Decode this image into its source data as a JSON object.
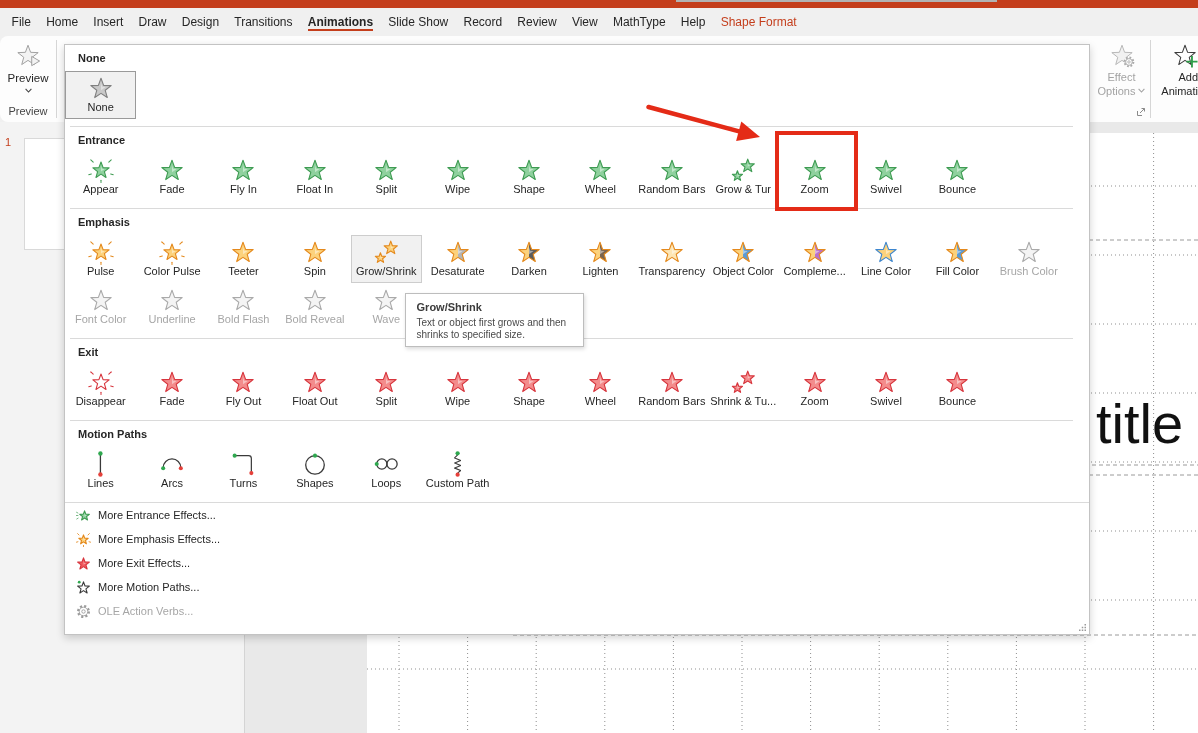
{
  "tabs": [
    {
      "label": "File",
      "selected": false,
      "contextual": false
    },
    {
      "label": "Home",
      "selected": false,
      "contextual": false
    },
    {
      "label": "Insert",
      "selected": false,
      "contextual": false
    },
    {
      "label": "Draw",
      "selected": false,
      "contextual": false
    },
    {
      "label": "Design",
      "selected": false,
      "contextual": false
    },
    {
      "label": "Transitions",
      "selected": false,
      "contextual": false
    },
    {
      "label": "Animations",
      "selected": true,
      "contextual": false
    },
    {
      "label": "Slide Show",
      "selected": false,
      "contextual": false
    },
    {
      "label": "Record",
      "selected": false,
      "contextual": false
    },
    {
      "label": "Review",
      "selected": false,
      "contextual": false
    },
    {
      "label": "View",
      "selected": false,
      "contextual": false
    },
    {
      "label": "MathType",
      "selected": false,
      "contextual": false
    },
    {
      "label": "Help",
      "selected": false,
      "contextual": false
    },
    {
      "label": "Shape Format",
      "selected": false,
      "contextual": true
    }
  ],
  "ribbon": {
    "preview_button": {
      "label": "Preview"
    },
    "preview_group_label": "Preview",
    "effect_options_button": {
      "label": "Effect Options",
      "disabled": true
    },
    "add_animation_button": {
      "label": "Add Animati"
    }
  },
  "animation_gallery": {
    "sections": [
      {
        "kind": "none",
        "title": "None",
        "items": [
          {
            "label": "None",
            "selected": true
          }
        ]
      },
      {
        "kind": "entrance",
        "title": "Entrance",
        "items": [
          {
            "label": "Appear"
          },
          {
            "label": "Fade"
          },
          {
            "label": "Fly In"
          },
          {
            "label": "Float In"
          },
          {
            "label": "Split"
          },
          {
            "label": "Wipe"
          },
          {
            "label": "Shape"
          },
          {
            "label": "Wheel"
          },
          {
            "label": "Random Bars"
          },
          {
            "label": "Grow & Tur"
          },
          {
            "label": "Zoom"
          },
          {
            "label": "Swivel"
          },
          {
            "label": "Bounce"
          }
        ]
      },
      {
        "kind": "emphasis",
        "title": "Emphasis",
        "items": [
          {
            "label": "Pulse",
            "hovered": false,
            "disabled": false
          },
          {
            "label": "Color Pulse",
            "hovered": false,
            "disabled": false
          },
          {
            "label": "Teeter",
            "hovered": false,
            "disabled": false
          },
          {
            "label": "Spin",
            "hovered": false,
            "disabled": false
          },
          {
            "label": "Grow/Shrink",
            "hovered": true,
            "disabled": false,
            "tooltip": {
              "title": "Grow/Shrink",
              "text": "Text or object first grows and then shrinks to specified size."
            }
          },
          {
            "label": "Desaturate",
            "hovered": false,
            "disabled": false
          },
          {
            "label": "Darken",
            "hovered": false,
            "disabled": false
          },
          {
            "label": "Lighten",
            "hovered": false,
            "disabled": false
          },
          {
            "label": "Transparency",
            "hovered": false,
            "disabled": false
          },
          {
            "label": "Object Color",
            "hovered": false,
            "disabled": false
          },
          {
            "label": "Compleme...",
            "hovered": false,
            "disabled": false
          },
          {
            "label": "Line Color",
            "hovered": false,
            "disabled": false
          },
          {
            "label": "Fill Color",
            "hovered": false,
            "disabled": false
          },
          {
            "label": "Brush Color",
            "hovered": false,
            "disabled": true
          },
          {
            "label": "Font Color",
            "hovered": false,
            "disabled": true
          },
          {
            "label": "Underline",
            "hovered": false,
            "disabled": true
          },
          {
            "label": "Bold Flash",
            "hovered": false,
            "disabled": true
          },
          {
            "label": "Bold Reveal",
            "hovered": false,
            "disabled": true
          },
          {
            "label": "Wave",
            "hovered": false,
            "disabled": true
          }
        ]
      },
      {
        "kind": "exit",
        "title": "Exit",
        "items": [
          {
            "label": "Disappear"
          },
          {
            "label": "Fade"
          },
          {
            "label": "Fly Out"
          },
          {
            "label": "Float Out"
          },
          {
            "label": "Split"
          },
          {
            "label": "Wipe"
          },
          {
            "label": "Shape"
          },
          {
            "label": "Wheel"
          },
          {
            "label": "Random Bars"
          },
          {
            "label": "Shrink & Tu..."
          },
          {
            "label": "Zoom"
          },
          {
            "label": "Swivel"
          },
          {
            "label": "Bounce"
          }
        ]
      },
      {
        "kind": "motion_paths",
        "title": "Motion Paths",
        "items": [
          {
            "label": "Lines"
          },
          {
            "label": "Arcs"
          },
          {
            "label": "Turns"
          },
          {
            "label": "Shapes"
          },
          {
            "label": "Loops"
          },
          {
            "label": "Custom Path"
          }
        ]
      }
    ],
    "more_menu": [
      {
        "label": "More Entrance Effects...",
        "disabled": false
      },
      {
        "label": "More Emphasis Effects...",
        "disabled": false
      },
      {
        "label": "More Exit Effects...",
        "disabled": false
      },
      {
        "label": "More Motion Paths...",
        "disabled": false
      },
      {
        "label": "OLE Action Verbs...",
        "disabled": true
      }
    ]
  },
  "slides_panel": {
    "slide_number": "1"
  },
  "slide": {
    "title": "title"
  }
}
